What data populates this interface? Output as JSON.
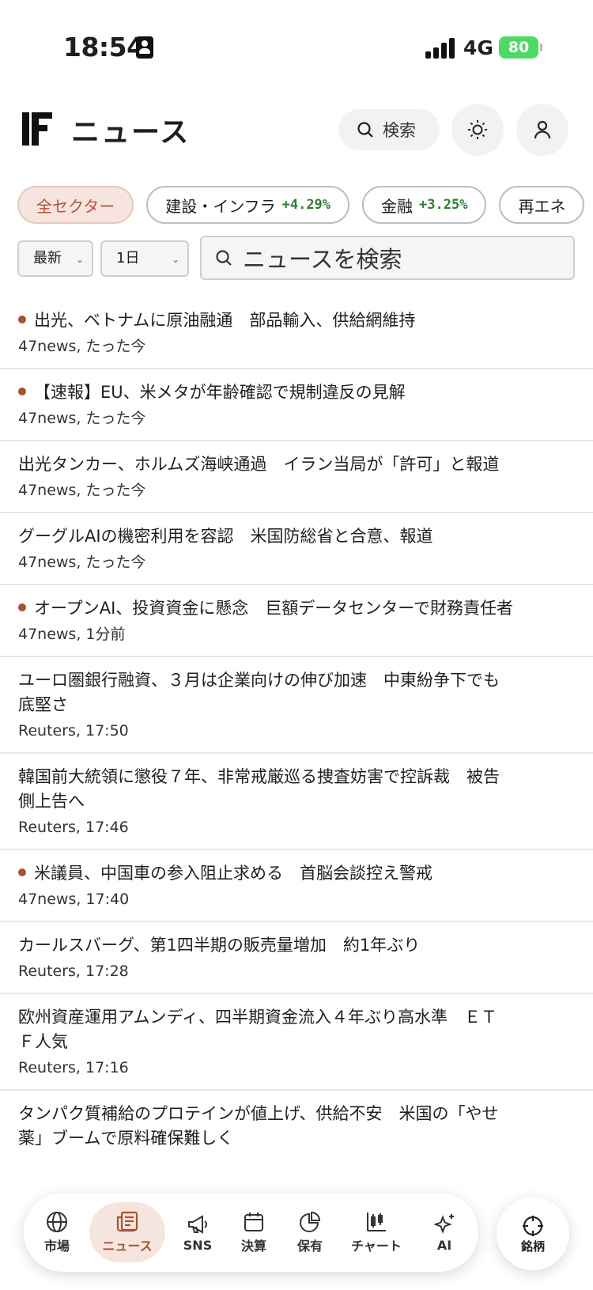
{
  "status": {
    "time": "18:54",
    "network": "4G",
    "battery": "80"
  },
  "header": {
    "title": "ニュース",
    "search_label": "検索"
  },
  "sector_chips": [
    {
      "label": "全セクター",
      "pct": ""
    },
    {
      "label": "建設・インフラ",
      "pct": "+4.29%"
    },
    {
      "label": "金融",
      "pct": "+3.25%"
    },
    {
      "label": "再エネ",
      "pct": ""
    }
  ],
  "filters": {
    "sort": "最新",
    "period": "1日",
    "search_placeholder": "ニュースを検索"
  },
  "news": [
    {
      "headline": "出光、ベトナムに原油融通　部品輸入、供給網維持",
      "meta": "47news, たった今",
      "unread": true
    },
    {
      "headline": "【速報】EU、米メタが年齢確認で規制違反の見解",
      "meta": "47news, たった今",
      "unread": true
    },
    {
      "headline": "出光タンカー、ホルムズ海峡通過　イラン当局が「許可」と報道",
      "meta": "47news, たった今",
      "unread": false
    },
    {
      "headline": "グーグルAIの機密利用を容認　米国防総省と合意、報道",
      "meta": "47news, たった今",
      "unread": false
    },
    {
      "headline": "オープンAI、投資資金に懸念　巨額データセンターで財務責任者",
      "meta": "47news, 1分前",
      "unread": true
    },
    {
      "headline": "ユーロ圏銀行融資、３月は企業向けの伸び加速　中東紛争下でも底堅さ",
      "meta": "Reuters, 17:50",
      "unread": false
    },
    {
      "headline": "韓国前大統領に懲役７年、非常戒厳巡る捜査妨害で控訴裁　被告側上告へ",
      "meta": "Reuters, 17:46",
      "unread": false
    },
    {
      "headline": "米議員、中国車の参入阻止求める　首脳会談控え警戒",
      "meta": "47news, 17:40",
      "unread": true
    },
    {
      "headline": "カールスバーグ、第1四半期の販売量増加　約1年ぶり",
      "meta": "Reuters, 17:28",
      "unread": false
    },
    {
      "headline": "欧州資産運用アムンディ、四半期資金流入４年ぶり高水準　ＥＴＦ人気",
      "meta": "Reuters, 17:16",
      "unread": false
    },
    {
      "headline": "タンパク質補給のプロテインが値上げ、供給不安　米国の「やせ薬」ブームで原料確保難しく",
      "meta": "",
      "unread": false
    }
  ],
  "tabbar": {
    "tabs": [
      {
        "label": "市場",
        "icon": "globe-icon"
      },
      {
        "label": "ニュース",
        "icon": "newspaper-icon"
      },
      {
        "label": "SNS",
        "icon": "megaphone-icon"
      },
      {
        "label": "決算",
        "icon": "calendar-icon"
      },
      {
        "label": "保有",
        "icon": "pie-chart-icon"
      },
      {
        "label": "チャート",
        "icon": "candlestick-chart-icon"
      },
      {
        "label": "AI",
        "icon": "sparkle-icon"
      }
    ],
    "active": "ニュース",
    "fab_label": "銘柄"
  },
  "colors": {
    "accent": "#a8522f",
    "accent_bg": "#f6e5df",
    "positive": "#2f7d32",
    "battery": "#4cd964"
  }
}
